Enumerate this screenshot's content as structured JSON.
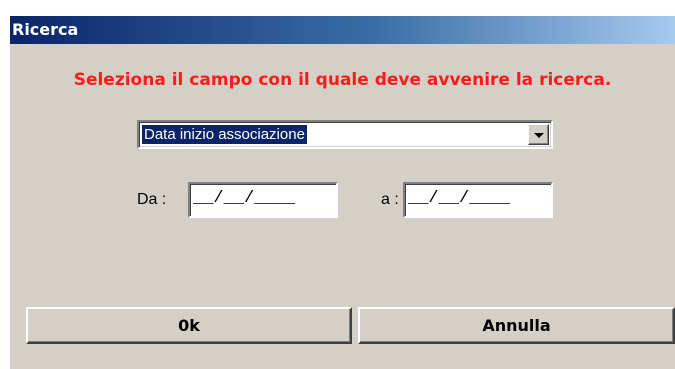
{
  "window": {
    "title": "Ricerca"
  },
  "instruction": "Seleziona il campo con il quale deve avvenire la ricerca.",
  "field_select": {
    "selected": "Data inizio associazione",
    "icon": "chevron-down-icon"
  },
  "date_range": {
    "from_label": "Da :",
    "from_value": "__/__/____",
    "to_label": "a :",
    "to_value": "__/__/____"
  },
  "buttons": {
    "ok": "0k",
    "cancel": "Annulla"
  },
  "colors": {
    "title_bar": "#0a246a",
    "instruction_text": "#ff1a1a",
    "dialog_face": "#d4d0c8",
    "selection": "#0a246a"
  }
}
